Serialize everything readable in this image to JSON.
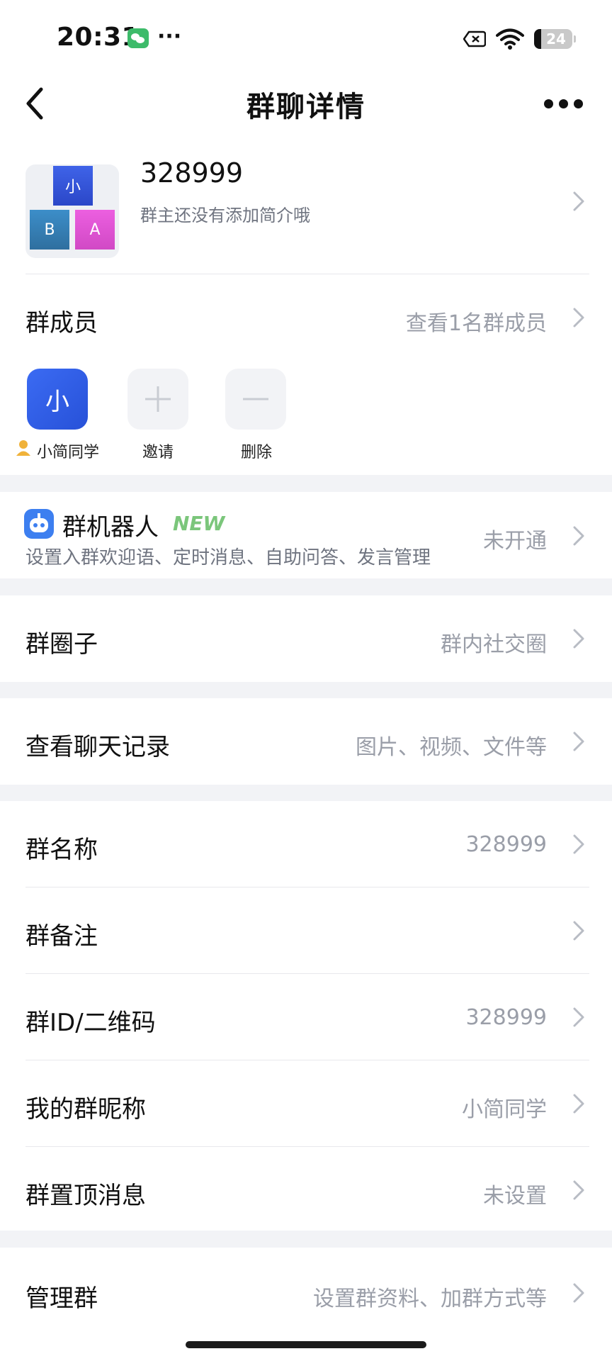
{
  "status_bar": {
    "time": "20:31",
    "more": "···",
    "battery": "24"
  },
  "header": {
    "title": "群聊详情"
  },
  "group": {
    "avatar_tiles": [
      "小",
      "B",
      "A"
    ],
    "name": "328999",
    "description": "群主还没有添加简介哦"
  },
  "members": {
    "label": "群成员",
    "view_all": "查看1名群成员",
    "items": [
      {
        "avatar_text": "小",
        "name": "小简同学"
      },
      {
        "name": "邀请"
      },
      {
        "name": "删除"
      }
    ]
  },
  "bot": {
    "title": "群机器人",
    "badge": "NEW",
    "description": "设置入群欢迎语、定时消息、自助问答、发言管理",
    "status": "未开通"
  },
  "circle": {
    "label": "群圈子",
    "value": "群内社交圈"
  },
  "history": {
    "label": "查看聊天记录",
    "value": "图片、视频、文件等"
  },
  "settings": [
    {
      "label": "群名称",
      "value": "328999"
    },
    {
      "label": "群备注",
      "value": ""
    },
    {
      "label": "群ID/二维码",
      "value": "328999"
    },
    {
      "label": "我的群昵称",
      "value": "小简同学"
    },
    {
      "label": "群置顶消息",
      "value": "未设置"
    }
  ],
  "manage": {
    "label": "管理群",
    "value": "设置群资料、加群方式等"
  },
  "colors": {
    "accent_blue": "#2f5ce6",
    "new_badge": "#7bc67b",
    "secondary_text": "#9a9ea8"
  }
}
